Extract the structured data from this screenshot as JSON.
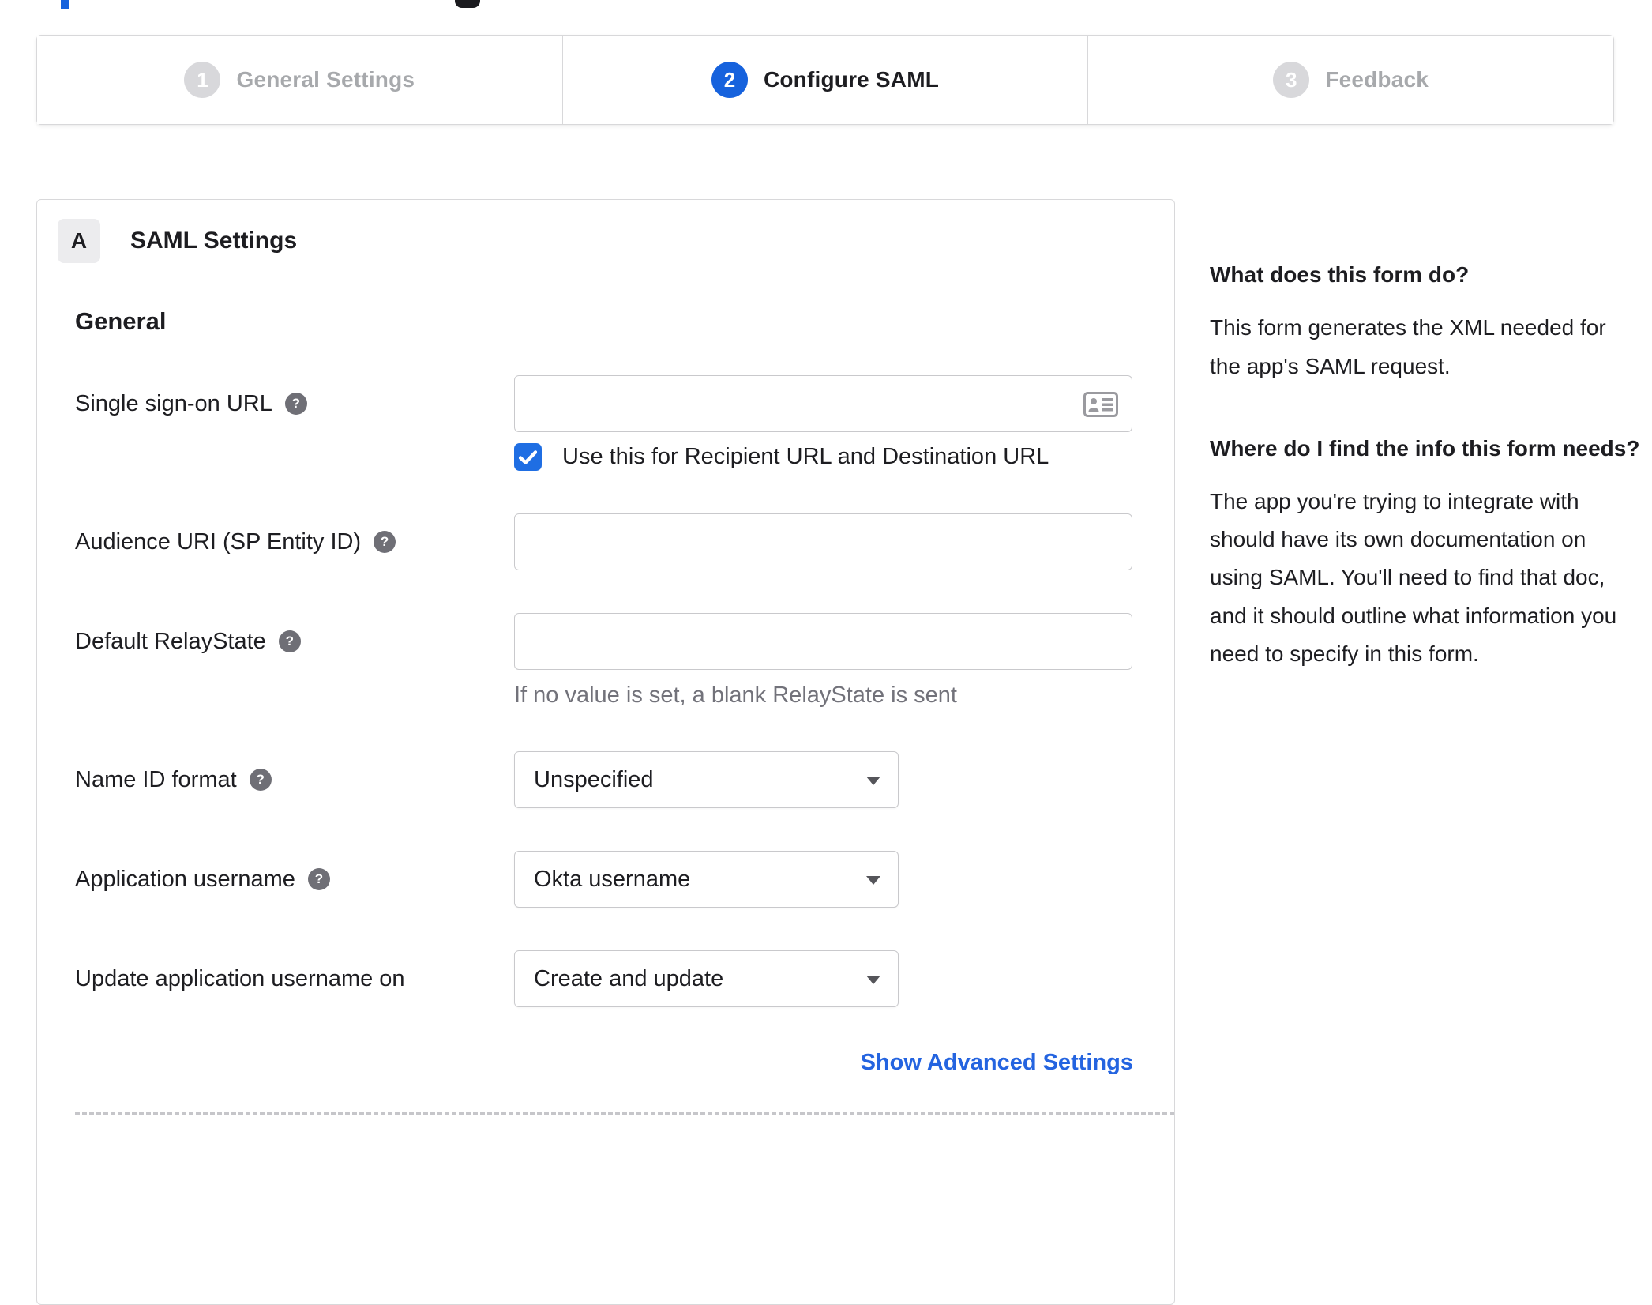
{
  "colors": {
    "accent_blue": "#1662dd",
    "checkbox_blue": "#1f6ee3",
    "link_blue": "#2464e0",
    "inactive_text_gray": "#a7a9ac",
    "inactive_badge_gray": "#d8d8db",
    "helper_text_gray": "#72727a"
  },
  "stepper": {
    "steps": [
      {
        "number": "1",
        "label": "General Settings",
        "state": "inactive"
      },
      {
        "number": "2",
        "label": "Configure SAML",
        "state": "active"
      },
      {
        "number": "3",
        "label": "Feedback",
        "state": "inactive"
      }
    ]
  },
  "panel": {
    "section_badge": "A",
    "section_title": "SAML Settings",
    "group_heading": "General",
    "fields": {
      "sso_url": {
        "label": "Single sign-on URL",
        "value": "",
        "checkbox_label": "Use this for Recipient URL and Destination URL",
        "checkbox_checked": true
      },
      "audience_uri": {
        "label": "Audience URI (SP Entity ID)",
        "value": ""
      },
      "default_relay_state": {
        "label": "Default RelayState",
        "value": "",
        "helper": "If no value is set, a blank RelayState is sent"
      },
      "name_id_format": {
        "label": "Name ID format",
        "value": "Unspecified"
      },
      "application_username": {
        "label": "Application username",
        "value": "Okta username"
      },
      "update_app_username": {
        "label": "Update application username on",
        "value": "Create and update"
      }
    },
    "advanced_link": "Show Advanced Settings"
  },
  "help_panel": {
    "heading_1": "What does this form do?",
    "paragraph_1": "This form generates the XML needed for the app's SAML request.",
    "heading_2": "Where do I find the info this form needs?",
    "paragraph_2": "The app you're trying to integrate with should have its own documentation on using SAML. You'll need to find that doc, and it should outline what information you need to specify in this form."
  },
  "glyphs": {
    "question_mark": "?"
  }
}
